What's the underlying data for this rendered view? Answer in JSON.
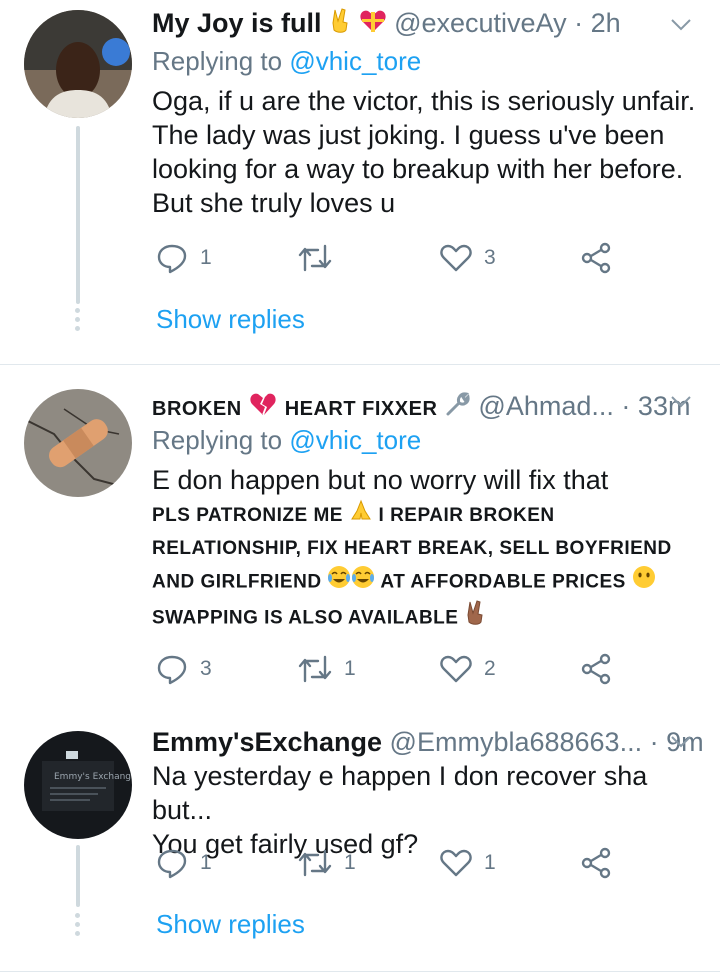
{
  "tweets": [
    {
      "display_name": "My Joy is full",
      "name_emojis": [
        "victory-hand-emoji",
        "heart-gift-emoji"
      ],
      "handle": "@executiveAy",
      "separator": "·",
      "time": "2h",
      "replying_prefix": "Replying to",
      "replying_to": "@vhic_tore",
      "text": "Oga, if u are the victor, this is seriously unfair. The lady was just joking. I guess u've been looking for a way to breakup with her before. But she truly loves u",
      "replies": "1",
      "retweets": "",
      "likes": "3",
      "show_replies": "Show replies"
    },
    {
      "display_name_part1": "BROKEN",
      "display_name_part2": "HEART FIXXER",
      "name_emojis": [
        "broken-heart-emoji",
        "wrench-emoji"
      ],
      "handle": "@Ahmad...",
      "separator": "·",
      "time": "33m",
      "replying_prefix": "Replying to",
      "replying_to": "@vhic_tore",
      "text": "E don happen but no worry will fix that",
      "caps_lines": [
        "PLS PATRONIZE ME",
        "I REPAIR BROKEN",
        "RELATIONSHIP, FIX HEART BREAK, SELL BOYFRIEND",
        "AND GIRLFRIEND",
        "AT AFFORDABLE PRICES",
        "SWAPPING IS ALSO AVAILABLE"
      ],
      "replies": "3",
      "retweets": "1",
      "likes": "2"
    },
    {
      "display_name": "Emmy'sExchange",
      "handle": "@Emmybla688663...",
      "separator": "·",
      "time": "9m",
      "text_line1": "Na yesterday e happen I don recover sha but...",
      "text_line2": "You get fairly used gf?",
      "replies": "1",
      "retweets": "1",
      "likes": "1",
      "show_replies": "Show replies"
    }
  ],
  "colors": {
    "accent": "#1da1f2",
    "secondary_text": "#657786",
    "divider": "#e1e8ed",
    "thread_line": "#cfd9de"
  }
}
